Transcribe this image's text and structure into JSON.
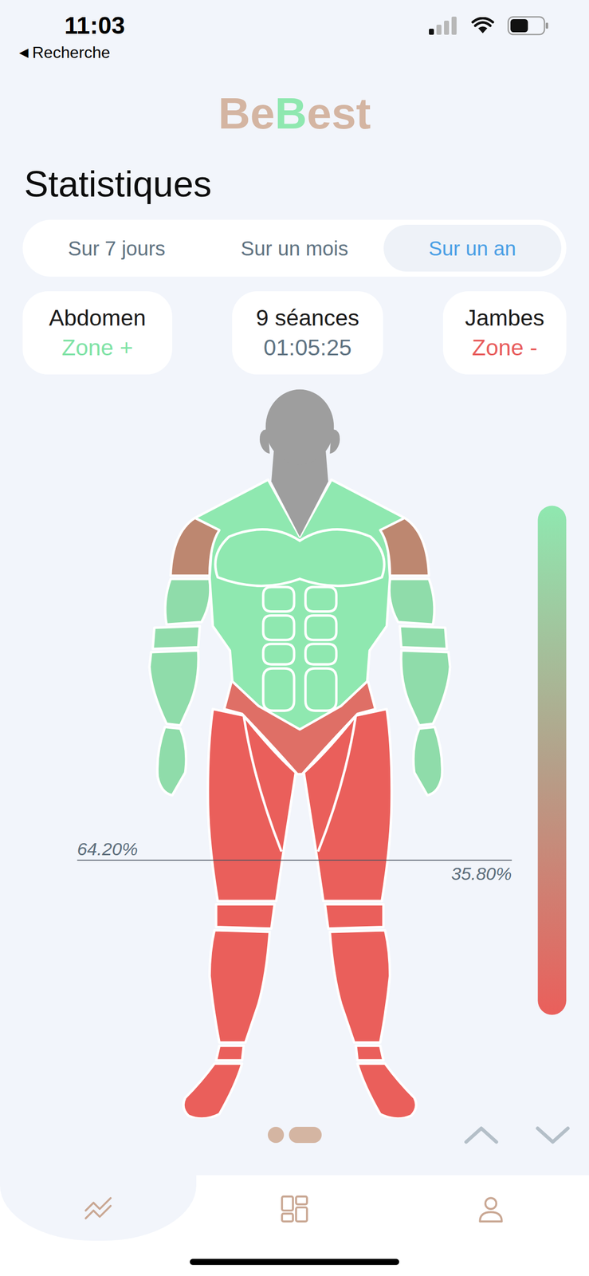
{
  "status_bar": {
    "time": "11:03",
    "back_icon": "◀",
    "back_label": "Recherche",
    "signal_level": 0.25,
    "battery_level": 0.55
  },
  "logo": [
    {
      "text": "Be",
      "color": "#d4b5a2"
    },
    {
      "text": "B",
      "color": "#8fe8b0"
    },
    {
      "text": "est",
      "color": "#d4b5a2"
    }
  ],
  "title": "Statistiques",
  "tabs": [
    {
      "label": "Sur 7 jours",
      "selected": false
    },
    {
      "label": "Sur un mois",
      "selected": false
    },
    {
      "label": "Sur un an",
      "selected": true
    }
  ],
  "summary": [
    {
      "title": "Abdomen",
      "value": "Zone +",
      "color": "#7fe3a6"
    },
    {
      "title": "9 séances",
      "value": "01:05:25"
    },
    {
      "title": "Jambes",
      "value": "Zone -",
      "color": "#e85c5c"
    }
  ],
  "figure": {
    "regions": [
      {
        "kind": "legs",
        "color": "#ea5f5b"
      },
      {
        "kind": "hips",
        "color": "#df6f66"
      },
      {
        "kind": "arms",
        "color": "#8fdcaa"
      },
      {
        "kind": "torso",
        "color": "#8fe8b0"
      },
      {
        "kind": "shoulders",
        "color": "#bd8770"
      },
      {
        "kind": "head",
        "color": "#9e9e9e"
      }
    ],
    "split": {
      "level": 0.642,
      "upper": "64.20%",
      "lower": "35.80%"
    }
  },
  "pager": [
    {
      "selected": false
    },
    {
      "selected": true
    }
  ],
  "nav": [
    {
      "kind": "stats",
      "selected": true
    },
    {
      "kind": "dashboard",
      "selected": false
    },
    {
      "kind": "profile",
      "selected": false
    }
  ]
}
